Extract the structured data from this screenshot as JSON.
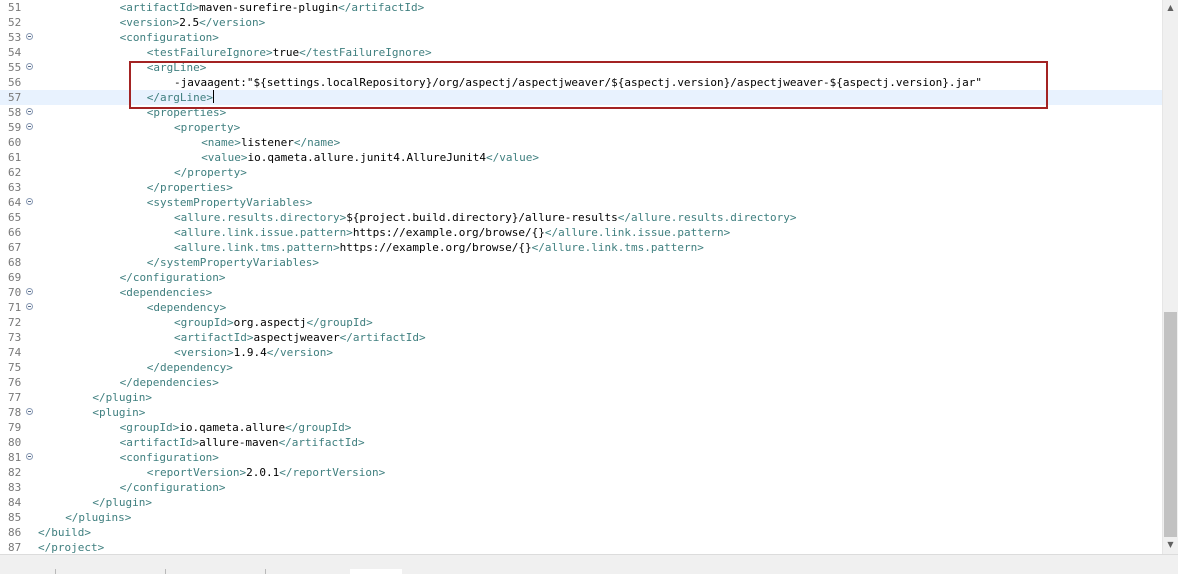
{
  "editor": {
    "lines": [
      {
        "n": "51",
        "indent": 12,
        "parts": [
          [
            "t",
            "<artifactId>"
          ],
          [
            "x",
            "maven-surefire-plugin"
          ],
          [
            "t",
            "</artifactId>"
          ]
        ]
      },
      {
        "n": "52",
        "indent": 12,
        "parts": [
          [
            "t",
            "<version>"
          ],
          [
            "x",
            "2.5"
          ],
          [
            "t",
            "</version>"
          ]
        ]
      },
      {
        "n": "53",
        "fold": true,
        "indent": 12,
        "parts": [
          [
            "t",
            "<configuration>"
          ]
        ]
      },
      {
        "n": "54",
        "indent": 16,
        "parts": [
          [
            "t",
            "<testFailureIgnore>"
          ],
          [
            "x",
            "true"
          ],
          [
            "t",
            "</testFailureIgnore>"
          ]
        ]
      },
      {
        "n": "55",
        "fold": true,
        "indent": 16,
        "parts": [
          [
            "t",
            "<argLine>"
          ]
        ]
      },
      {
        "n": "56",
        "indent": 20,
        "parts": [
          [
            "x",
            "-javaagent:\"${settings.localRepository}/org/aspectj/aspectjweaver/${aspectj.version}/aspectjweaver-${aspectj.version}.jar\""
          ]
        ]
      },
      {
        "n": "57",
        "indent": 16,
        "current": true,
        "caret": true,
        "parts": [
          [
            "t",
            "</argLine>"
          ]
        ]
      },
      {
        "n": "58",
        "fold": true,
        "indent": 16,
        "parts": [
          [
            "t",
            "<properties>"
          ]
        ]
      },
      {
        "n": "59",
        "fold": true,
        "indent": 20,
        "parts": [
          [
            "t",
            "<property>"
          ]
        ]
      },
      {
        "n": "60",
        "indent": 24,
        "parts": [
          [
            "t",
            "<name>"
          ],
          [
            "x",
            "listener"
          ],
          [
            "t",
            "</name>"
          ]
        ]
      },
      {
        "n": "61",
        "indent": 24,
        "parts": [
          [
            "t",
            "<value>"
          ],
          [
            "x",
            "io.qameta.allure.junit4.AllureJunit4"
          ],
          [
            "t",
            "</value>"
          ]
        ]
      },
      {
        "n": "62",
        "indent": 20,
        "parts": [
          [
            "t",
            "</property>"
          ]
        ]
      },
      {
        "n": "63",
        "indent": 16,
        "parts": [
          [
            "t",
            "</properties>"
          ]
        ]
      },
      {
        "n": "64",
        "fold": true,
        "indent": 16,
        "parts": [
          [
            "t",
            "<systemPropertyVariables>"
          ]
        ]
      },
      {
        "n": "65",
        "indent": 20,
        "parts": [
          [
            "t",
            "<allure.results.directory>"
          ],
          [
            "x",
            "${project.build.directory}/allure-results"
          ],
          [
            "t",
            "</allure.results.directory>"
          ]
        ]
      },
      {
        "n": "66",
        "indent": 20,
        "parts": [
          [
            "t",
            "<allure.link.issue.pattern>"
          ],
          [
            "x",
            "https://example.org/browse/{}"
          ],
          [
            "t",
            "</allure.link.issue.pattern>"
          ]
        ]
      },
      {
        "n": "67",
        "indent": 20,
        "parts": [
          [
            "t",
            "<allure.link.tms.pattern>"
          ],
          [
            "x",
            "https://example.org/browse/{}"
          ],
          [
            "t",
            "</allure.link.tms.pattern>"
          ]
        ]
      },
      {
        "n": "68",
        "indent": 16,
        "parts": [
          [
            "t",
            "</systemPropertyVariables>"
          ]
        ]
      },
      {
        "n": "69",
        "indent": 12,
        "parts": [
          [
            "t",
            "</configuration>"
          ]
        ]
      },
      {
        "n": "70",
        "fold": true,
        "indent": 12,
        "parts": [
          [
            "t",
            "<dependencies>"
          ]
        ]
      },
      {
        "n": "71",
        "fold": true,
        "indent": 16,
        "parts": [
          [
            "t",
            "<dependency>"
          ]
        ]
      },
      {
        "n": "72",
        "indent": 20,
        "parts": [
          [
            "t",
            "<groupId>"
          ],
          [
            "x",
            "org.aspectj"
          ],
          [
            "t",
            "</groupId>"
          ]
        ]
      },
      {
        "n": "73",
        "indent": 20,
        "parts": [
          [
            "t",
            "<artifactId>"
          ],
          [
            "x",
            "aspectjweaver"
          ],
          [
            "t",
            "</artifactId>"
          ]
        ]
      },
      {
        "n": "74",
        "indent": 20,
        "parts": [
          [
            "t",
            "<version>"
          ],
          [
            "x",
            "1.9.4"
          ],
          [
            "t",
            "</version>"
          ]
        ]
      },
      {
        "n": "75",
        "indent": 16,
        "parts": [
          [
            "t",
            "</dependency>"
          ]
        ]
      },
      {
        "n": "76",
        "indent": 12,
        "parts": [
          [
            "t",
            "</dependencies>"
          ]
        ]
      },
      {
        "n": "77",
        "indent": 8,
        "parts": [
          [
            "t",
            "</plugin>"
          ]
        ]
      },
      {
        "n": "78",
        "fold": true,
        "indent": 8,
        "parts": [
          [
            "t",
            "<plugin>"
          ]
        ]
      },
      {
        "n": "79",
        "indent": 12,
        "parts": [
          [
            "t",
            "<groupId>"
          ],
          [
            "x",
            "io.qameta.allure"
          ],
          [
            "t",
            "</groupId>"
          ]
        ]
      },
      {
        "n": "80",
        "indent": 12,
        "parts": [
          [
            "t",
            "<artifactId>"
          ],
          [
            "x",
            "allure-maven"
          ],
          [
            "t",
            "</artifactId>"
          ]
        ]
      },
      {
        "n": "81",
        "fold": true,
        "indent": 12,
        "parts": [
          [
            "t",
            "<configuration>"
          ]
        ]
      },
      {
        "n": "82",
        "indent": 16,
        "parts": [
          [
            "t",
            "<reportVersion>"
          ],
          [
            "x",
            "2.0.1"
          ],
          [
            "t",
            "</reportVersion>"
          ]
        ]
      },
      {
        "n": "83",
        "indent": 12,
        "parts": [
          [
            "t",
            "</configuration>"
          ]
        ]
      },
      {
        "n": "84",
        "indent": 8,
        "parts": [
          [
            "t",
            "</plugin>"
          ]
        ]
      },
      {
        "n": "85",
        "indent": 4,
        "parts": [
          [
            "t",
            "</plugins>"
          ]
        ]
      },
      {
        "n": "86",
        "indent": 0,
        "parts": [
          [
            "t",
            "</build>"
          ]
        ]
      },
      {
        "n": "87",
        "indent": 0,
        "parts": [
          [
            "t",
            "</project>"
          ]
        ]
      }
    ]
  },
  "scrollbar": {
    "up_icon": "chevron-up-icon",
    "down_icon": "chevron-down-icon"
  },
  "colors": {
    "tag": "#3f7f7f",
    "text": "#000000",
    "line_number": "#787878",
    "current_line": "#e8f2fe",
    "highlight_box": "#a32323"
  }
}
